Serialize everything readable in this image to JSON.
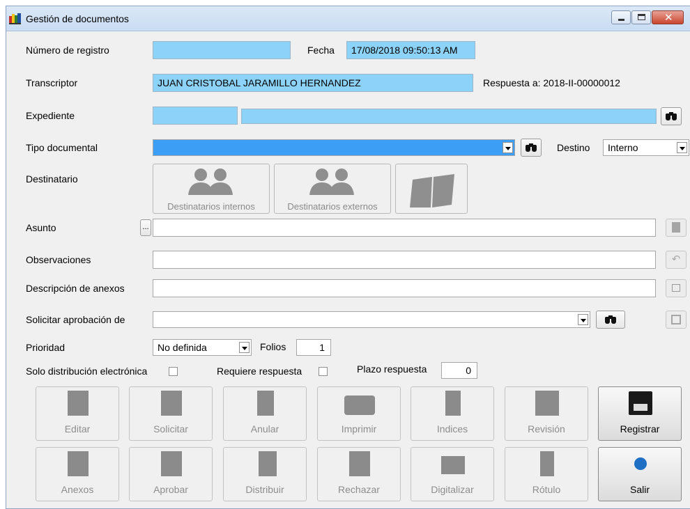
{
  "window": {
    "title": "Gestión de documentos"
  },
  "form": {
    "numero_registro_label": "Número de registro",
    "numero_registro_value": "",
    "fecha_label": "Fecha",
    "fecha_value": "17/08/2018 09:50:13 AM",
    "transcriptor_label": "Transcriptor",
    "transcriptor_value": "JUAN CRISTOBAL JARAMILLO HERNANDEZ",
    "respuesta_text": "Respuesta a: 2018-II-00000012",
    "expediente_label": "Expediente",
    "tipo_documental_label": "Tipo documental",
    "tipo_documental_value": "",
    "destino_label": "Destino",
    "destino_value": "Interno",
    "destinatario_label": "Destinatario",
    "destinatarios_internos": "Destinatarios internos",
    "destinatarios_externos": "Destinatarios externos",
    "asunto_label": "Asunto",
    "asunto_button": "...",
    "observaciones_label": "Observaciones",
    "descripcion_anexos_label": "Descripción de anexos",
    "solicitar_aprobacion_label": "Solicitar aprobación de",
    "prioridad_label": "Prioridad",
    "prioridad_value": "No definida",
    "folios_label": "Folios",
    "folios_value": "1",
    "solo_distribucion_label": "Solo distribución electrónica",
    "requiere_respuesta_label": "Requiere respuesta",
    "plazo_respuesta_label": "Plazo respuesta",
    "plazo_respuesta_value": "0"
  },
  "actions_row1": [
    {
      "label": "Editar",
      "icon": "edit-icon"
    },
    {
      "label": "Solicitar",
      "icon": "request-icon"
    },
    {
      "label": "Anular",
      "icon": "cancel-document-icon"
    },
    {
      "label": "Imprimir",
      "icon": "printer-icon"
    },
    {
      "label": "Indices",
      "icon": "index-search-icon"
    },
    {
      "label": "Revisión",
      "icon": "review-icon"
    },
    {
      "label": "Registrar",
      "icon": "floppy-disk-icon"
    }
  ],
  "actions_row2": [
    {
      "label": "Anexos",
      "icon": "attachments-icon"
    },
    {
      "label": "Aprobar",
      "icon": "approve-icon"
    },
    {
      "label": "Distribuir",
      "icon": "distribute-icon"
    },
    {
      "label": "Rechazar",
      "icon": "reject-icon"
    },
    {
      "label": "Digitalizar",
      "icon": "scanner-icon"
    },
    {
      "label": "Rótulo",
      "icon": "label-icon"
    },
    {
      "label": "Salir",
      "icon": "exit-icon"
    }
  ]
}
